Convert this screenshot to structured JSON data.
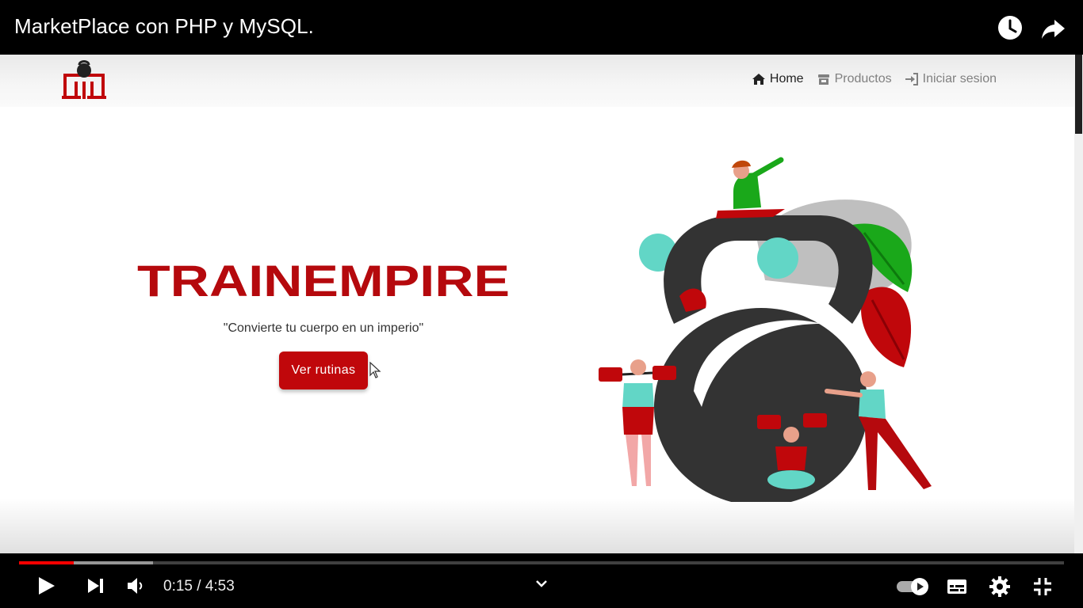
{
  "player": {
    "video_title": "MarketPlace con PHP y MySQL.",
    "current_time": "0:15",
    "separator": "/",
    "duration": "4:53",
    "progress_fraction": 0.052,
    "buffered_fraction": 0.128,
    "icons": [
      "watch-later-icon",
      "share-icon",
      "play-icon",
      "next-icon",
      "volume-icon",
      "chevron-down-icon",
      "autoplay-toggle-icon",
      "captions-icon",
      "settings-icon",
      "exit-fullscreen-icon"
    ],
    "colors": {
      "progress": "#ff0000",
      "background": "#000000"
    }
  },
  "site": {
    "nav": {
      "home": "Home",
      "products": "Productos",
      "login": "Iniciar sesion"
    },
    "brand": "TRAINEMPIRE",
    "tagline": "\"Convierte tu cuerpo en un imperio\"",
    "cta": "Ver rutinas",
    "colors": {
      "brand_red": "#c0070b",
      "kettlebell": "#333333",
      "accent_teal": "#62d6c6",
      "accent_green": "#1aa81a"
    }
  }
}
